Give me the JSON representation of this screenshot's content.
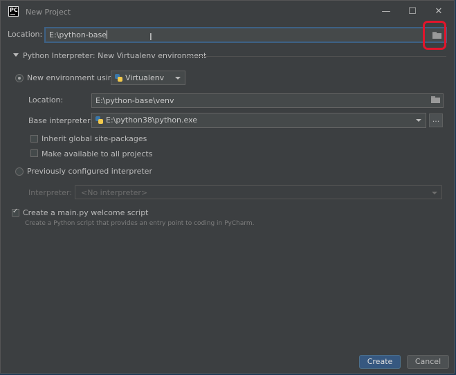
{
  "window": {
    "title": "New Project",
    "minimize": "—",
    "maximize": "☐",
    "close": "✕"
  },
  "app_icon": "PC",
  "location": {
    "label": "Location:",
    "value": "E:\\python-base"
  },
  "interpreter_section": {
    "title": "Python Interpreter: New Virtualenv environment"
  },
  "new_env": {
    "label": "New environment using",
    "tool": "Virtualenv",
    "selected": true,
    "location_label": "Location:",
    "location_value": "E:\\python-base\\venv",
    "base_label": "Base interpreter:",
    "base_value": "E:\\python38\\python.exe",
    "browse": "...",
    "inherit_label": "Inherit global site-packages",
    "inherit_checked": false,
    "available_label": "Make available to all projects",
    "available_checked": false
  },
  "previous": {
    "label": "Previously configured interpreter",
    "selected": false,
    "interpreter_label": "Interpreter:",
    "interpreter_value": "<No interpreter>"
  },
  "welcome": {
    "label": "Create a main.py welcome script",
    "checked": true,
    "hint": "Create a Python script that provides an entry point to coding in PyCharm."
  },
  "buttons": {
    "create": "Create",
    "cancel": "Cancel"
  },
  "cursor_glyph": "I",
  "colors": {
    "accent": "#365880",
    "highlight": "#e2152c",
    "background": "#3c3f41"
  }
}
